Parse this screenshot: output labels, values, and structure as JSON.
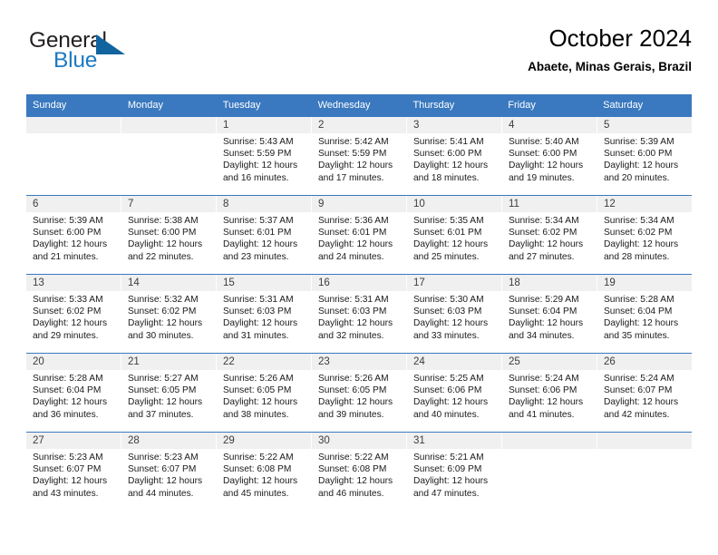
{
  "brand": {
    "name_part1": "General",
    "name_part2": "Blue",
    "accent_color": "#1b7ac4",
    "triangle_color": "#12649f"
  },
  "header": {
    "title": "October 2024",
    "subtitle": "Abaete, Minas Gerais, Brazil"
  },
  "theme": {
    "header_blue": "#3a79bf",
    "day_band_gray": "#f0f0f0"
  },
  "weekdays": [
    "Sunday",
    "Monday",
    "Tuesday",
    "Wednesday",
    "Thursday",
    "Friday",
    "Saturday"
  ],
  "weeks": [
    [
      {
        "day": "",
        "sunrise": "",
        "sunset": "",
        "daylight_line1": "",
        "daylight_line2": ""
      },
      {
        "day": "",
        "sunrise": "",
        "sunset": "",
        "daylight_line1": "",
        "daylight_line2": ""
      },
      {
        "day": "1",
        "sunrise": "Sunrise: 5:43 AM",
        "sunset": "Sunset: 5:59 PM",
        "daylight_line1": "Daylight: 12 hours",
        "daylight_line2": "and 16 minutes."
      },
      {
        "day": "2",
        "sunrise": "Sunrise: 5:42 AM",
        "sunset": "Sunset: 5:59 PM",
        "daylight_line1": "Daylight: 12 hours",
        "daylight_line2": "and 17 minutes."
      },
      {
        "day": "3",
        "sunrise": "Sunrise: 5:41 AM",
        "sunset": "Sunset: 6:00 PM",
        "daylight_line1": "Daylight: 12 hours",
        "daylight_line2": "and 18 minutes."
      },
      {
        "day": "4",
        "sunrise": "Sunrise: 5:40 AM",
        "sunset": "Sunset: 6:00 PM",
        "daylight_line1": "Daylight: 12 hours",
        "daylight_line2": "and 19 minutes."
      },
      {
        "day": "5",
        "sunrise": "Sunrise: 5:39 AM",
        "sunset": "Sunset: 6:00 PM",
        "daylight_line1": "Daylight: 12 hours",
        "daylight_line2": "and 20 minutes."
      }
    ],
    [
      {
        "day": "6",
        "sunrise": "Sunrise: 5:39 AM",
        "sunset": "Sunset: 6:00 PM",
        "daylight_line1": "Daylight: 12 hours",
        "daylight_line2": "and 21 minutes."
      },
      {
        "day": "7",
        "sunrise": "Sunrise: 5:38 AM",
        "sunset": "Sunset: 6:00 PM",
        "daylight_line1": "Daylight: 12 hours",
        "daylight_line2": "and 22 minutes."
      },
      {
        "day": "8",
        "sunrise": "Sunrise: 5:37 AM",
        "sunset": "Sunset: 6:01 PM",
        "daylight_line1": "Daylight: 12 hours",
        "daylight_line2": "and 23 minutes."
      },
      {
        "day": "9",
        "sunrise": "Sunrise: 5:36 AM",
        "sunset": "Sunset: 6:01 PM",
        "daylight_line1": "Daylight: 12 hours",
        "daylight_line2": "and 24 minutes."
      },
      {
        "day": "10",
        "sunrise": "Sunrise: 5:35 AM",
        "sunset": "Sunset: 6:01 PM",
        "daylight_line1": "Daylight: 12 hours",
        "daylight_line2": "and 25 minutes."
      },
      {
        "day": "11",
        "sunrise": "Sunrise: 5:34 AM",
        "sunset": "Sunset: 6:02 PM",
        "daylight_line1": "Daylight: 12 hours",
        "daylight_line2": "and 27 minutes."
      },
      {
        "day": "12",
        "sunrise": "Sunrise: 5:34 AM",
        "sunset": "Sunset: 6:02 PM",
        "daylight_line1": "Daylight: 12 hours",
        "daylight_line2": "and 28 minutes."
      }
    ],
    [
      {
        "day": "13",
        "sunrise": "Sunrise: 5:33 AM",
        "sunset": "Sunset: 6:02 PM",
        "daylight_line1": "Daylight: 12 hours",
        "daylight_line2": "and 29 minutes."
      },
      {
        "day": "14",
        "sunrise": "Sunrise: 5:32 AM",
        "sunset": "Sunset: 6:02 PM",
        "daylight_line1": "Daylight: 12 hours",
        "daylight_line2": "and 30 minutes."
      },
      {
        "day": "15",
        "sunrise": "Sunrise: 5:31 AM",
        "sunset": "Sunset: 6:03 PM",
        "daylight_line1": "Daylight: 12 hours",
        "daylight_line2": "and 31 minutes."
      },
      {
        "day": "16",
        "sunrise": "Sunrise: 5:31 AM",
        "sunset": "Sunset: 6:03 PM",
        "daylight_line1": "Daylight: 12 hours",
        "daylight_line2": "and 32 minutes."
      },
      {
        "day": "17",
        "sunrise": "Sunrise: 5:30 AM",
        "sunset": "Sunset: 6:03 PM",
        "daylight_line1": "Daylight: 12 hours",
        "daylight_line2": "and 33 minutes."
      },
      {
        "day": "18",
        "sunrise": "Sunrise: 5:29 AM",
        "sunset": "Sunset: 6:04 PM",
        "daylight_line1": "Daylight: 12 hours",
        "daylight_line2": "and 34 minutes."
      },
      {
        "day": "19",
        "sunrise": "Sunrise: 5:28 AM",
        "sunset": "Sunset: 6:04 PM",
        "daylight_line1": "Daylight: 12 hours",
        "daylight_line2": "and 35 minutes."
      }
    ],
    [
      {
        "day": "20",
        "sunrise": "Sunrise: 5:28 AM",
        "sunset": "Sunset: 6:04 PM",
        "daylight_line1": "Daylight: 12 hours",
        "daylight_line2": "and 36 minutes."
      },
      {
        "day": "21",
        "sunrise": "Sunrise: 5:27 AM",
        "sunset": "Sunset: 6:05 PM",
        "daylight_line1": "Daylight: 12 hours",
        "daylight_line2": "and 37 minutes."
      },
      {
        "day": "22",
        "sunrise": "Sunrise: 5:26 AM",
        "sunset": "Sunset: 6:05 PM",
        "daylight_line1": "Daylight: 12 hours",
        "daylight_line2": "and 38 minutes."
      },
      {
        "day": "23",
        "sunrise": "Sunrise: 5:26 AM",
        "sunset": "Sunset: 6:05 PM",
        "daylight_line1": "Daylight: 12 hours",
        "daylight_line2": "and 39 minutes."
      },
      {
        "day": "24",
        "sunrise": "Sunrise: 5:25 AM",
        "sunset": "Sunset: 6:06 PM",
        "daylight_line1": "Daylight: 12 hours",
        "daylight_line2": "and 40 minutes."
      },
      {
        "day": "25",
        "sunrise": "Sunrise: 5:24 AM",
        "sunset": "Sunset: 6:06 PM",
        "daylight_line1": "Daylight: 12 hours",
        "daylight_line2": "and 41 minutes."
      },
      {
        "day": "26",
        "sunrise": "Sunrise: 5:24 AM",
        "sunset": "Sunset: 6:07 PM",
        "daylight_line1": "Daylight: 12 hours",
        "daylight_line2": "and 42 minutes."
      }
    ],
    [
      {
        "day": "27",
        "sunrise": "Sunrise: 5:23 AM",
        "sunset": "Sunset: 6:07 PM",
        "daylight_line1": "Daylight: 12 hours",
        "daylight_line2": "and 43 minutes."
      },
      {
        "day": "28",
        "sunrise": "Sunrise: 5:23 AM",
        "sunset": "Sunset: 6:07 PM",
        "daylight_line1": "Daylight: 12 hours",
        "daylight_line2": "and 44 minutes."
      },
      {
        "day": "29",
        "sunrise": "Sunrise: 5:22 AM",
        "sunset": "Sunset: 6:08 PM",
        "daylight_line1": "Daylight: 12 hours",
        "daylight_line2": "and 45 minutes."
      },
      {
        "day": "30",
        "sunrise": "Sunrise: 5:22 AM",
        "sunset": "Sunset: 6:08 PM",
        "daylight_line1": "Daylight: 12 hours",
        "daylight_line2": "and 46 minutes."
      },
      {
        "day": "31",
        "sunrise": "Sunrise: 5:21 AM",
        "sunset": "Sunset: 6:09 PM",
        "daylight_line1": "Daylight: 12 hours",
        "daylight_line2": "and 47 minutes."
      },
      {
        "day": "",
        "sunrise": "",
        "sunset": "",
        "daylight_line1": "",
        "daylight_line2": ""
      },
      {
        "day": "",
        "sunrise": "",
        "sunset": "",
        "daylight_line1": "",
        "daylight_line2": ""
      }
    ]
  ]
}
